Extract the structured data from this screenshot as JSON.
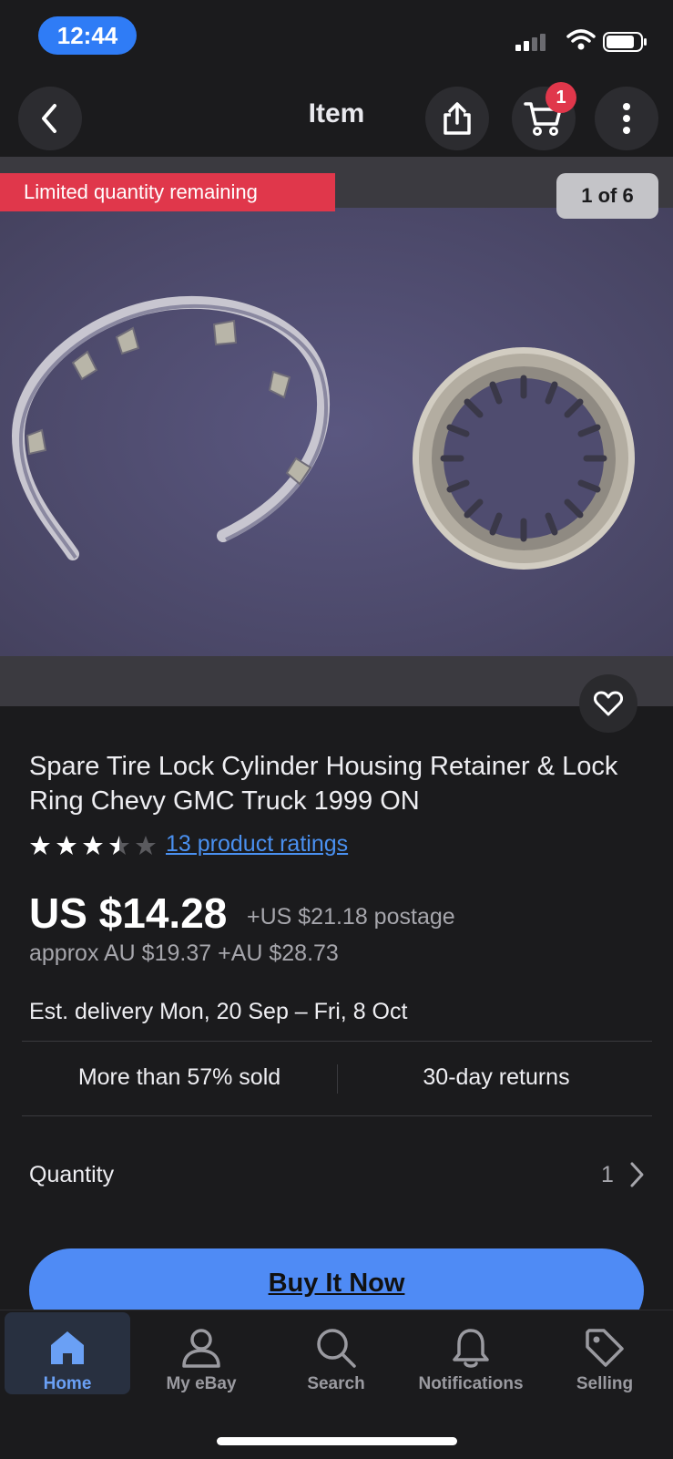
{
  "status_bar": {
    "time": "12:44"
  },
  "nav": {
    "title": "Item",
    "cart_count": "1"
  },
  "gallery": {
    "badge": "Limited quantity remaining",
    "counter": "1 of 6"
  },
  "item": {
    "title": "Spare Tire Lock Cylinder Housing Retainer & Lock Ring Chevy GMC Truck 1999 ON",
    "rating": 3.5,
    "ratings_link": "13 product ratings",
    "price": "US $14.28",
    "postage": "+US $21.18 postage",
    "approx": "approx AU $19.37 +AU $28.73",
    "delivery": "Est. delivery Mon, 20 Sep – Fri, 8 Oct",
    "sold": "More than 57% sold",
    "returns": "30-day returns",
    "quantity_label": "Quantity",
    "quantity_value": "1",
    "buy_label": "Buy It Now"
  },
  "tabs": [
    {
      "label": "Home",
      "icon": "home-icon",
      "active": true
    },
    {
      "label": "My eBay",
      "icon": "person-icon",
      "active": false
    },
    {
      "label": "Search",
      "icon": "search-icon",
      "active": false
    },
    {
      "label": "Notifications",
      "icon": "bell-icon",
      "active": false
    },
    {
      "label": "Selling",
      "icon": "tag-icon",
      "active": false
    }
  ],
  "colors": {
    "accent": "#4f8bf5",
    "badge_red": "#e0374b",
    "background": "#1b1b1d"
  }
}
